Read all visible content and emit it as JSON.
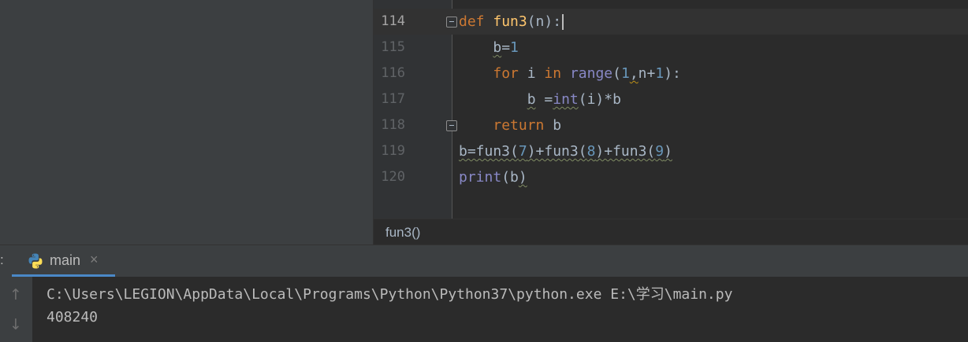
{
  "editor": {
    "lines": [
      {
        "no": "114"
      },
      {
        "no": "115"
      },
      {
        "no": "116"
      },
      {
        "no": "117"
      },
      {
        "no": "118"
      },
      {
        "no": "119"
      },
      {
        "no": "120"
      }
    ],
    "code": {
      "l114": {
        "kw": "def",
        "name": "fun3",
        "rest": "(n):"
      },
      "l115": {
        "var": "b",
        "op": "=",
        "num": "1"
      },
      "l116": {
        "kw_for": "for",
        "var": "i",
        "kw_in": "in",
        "bi": "range",
        "open": "(",
        "num1": "1",
        "comma": ",",
        "arg": "n+",
        "num2": "1",
        "close": "):"
      },
      "l117": {
        "var": "b",
        "op": " =",
        "bi": "int",
        "rest": "(i)*b"
      },
      "l118": {
        "kw": "return",
        "var": "b"
      },
      "l119": {
        "a": "b=fun3(",
        "n1": "7",
        "b": ")+fun3(",
        "n2": "8",
        "c": ")+fun3(",
        "n3": "9",
        "d": ")"
      },
      "l120": {
        "bi": "print",
        "open": "(",
        "arg": "b",
        "close": ")"
      }
    },
    "breadcrumb": "fun3()"
  },
  "run_panel": {
    "colon": ":",
    "tab_label": "main",
    "tab_close": "×",
    "up_arrow": "↑",
    "down_arrow": "↓",
    "output": [
      "C:\\Users\\LEGION\\AppData\\Local\\Programs\\Python\\Python37\\python.exe E:\\学习\\main.py",
      "408240"
    ]
  },
  "colors": {
    "keyword": "#cc7832",
    "function": "#ffc66d",
    "number": "#6897bb",
    "builtin": "#8888c6",
    "tab_underline": "#4a88c7"
  }
}
